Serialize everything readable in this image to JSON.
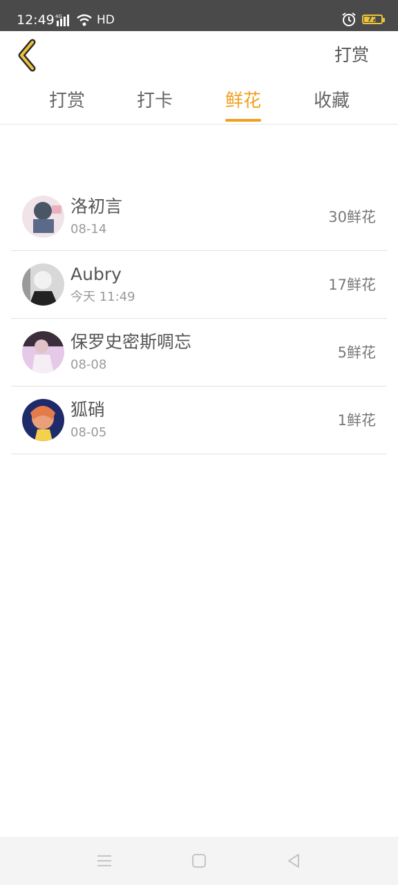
{
  "status_bar": {
    "time": "12:49",
    "network": "HD",
    "battery": "72",
    "battery_level": 0.72
  },
  "nav": {
    "action_label": "打赏"
  },
  "tabs": [
    {
      "label": "打赏",
      "active": false
    },
    {
      "label": "打卡",
      "active": false
    },
    {
      "label": "鲜花",
      "active": true
    },
    {
      "label": "收藏",
      "active": false
    }
  ],
  "list": [
    {
      "name": "洛初言",
      "date": "08-14",
      "count": "30鲜花"
    },
    {
      "name": "Aubry",
      "date": "今天 11:49",
      "count": "17鲜花"
    },
    {
      "name": "保罗史密斯啁忘",
      "date": "08-08",
      "count": "5鲜花"
    },
    {
      "name": "狐硝",
      "date": "08-05",
      "count": "1鲜花"
    }
  ],
  "colors": {
    "accent": "#f0a020",
    "status_bar_bg": "#4a4a4a"
  },
  "icons": {
    "back": "chevron-left-icon",
    "signal": "signal-icon",
    "wifi": "wifi-icon",
    "alarm": "alarm-icon",
    "battery": "battery-icon",
    "menu": "menu-icon",
    "home": "home-icon",
    "back_nav": "triangle-back-icon"
  }
}
